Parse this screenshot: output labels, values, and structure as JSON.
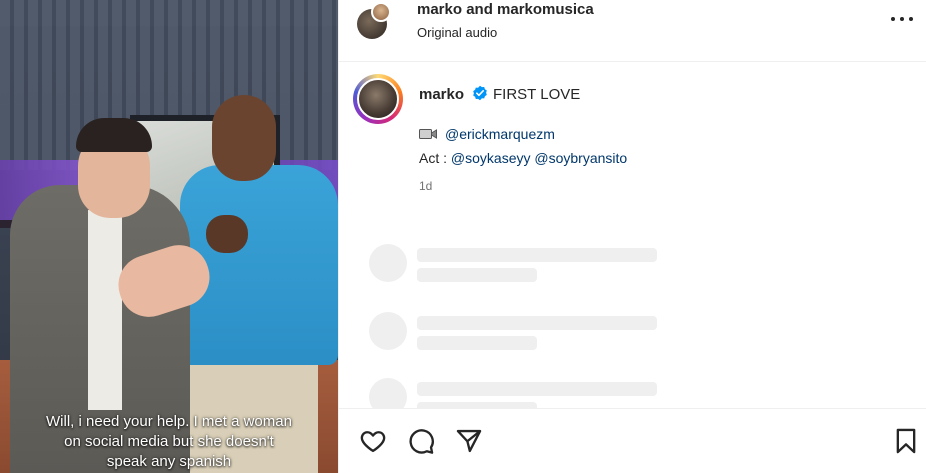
{
  "video": {
    "caption_lines": [
      "Will, i need your help. I met a woman",
      "on social media but she doesn't",
      "speak any spanish"
    ]
  },
  "header": {
    "title": "marko and markomusica",
    "subtitle": "Original audio",
    "more_icon": "more-horizontal-icon"
  },
  "post": {
    "username": "marko",
    "verified_icon": "verified-badge-icon",
    "caption_title": "FIRST LOVE",
    "camera_icon": "video-camera-icon",
    "credit_mention": "@erickmarquezm",
    "act_label": "Act :",
    "act_mentions": [
      "@soykaseyy",
      "@soybryansito"
    ],
    "time": "1d"
  },
  "actions": {
    "like_icon": "heart-icon",
    "comment_icon": "comment-icon",
    "share_icon": "send-icon",
    "save_icon": "bookmark-icon"
  },
  "colors": {
    "text": "#262626",
    "mention": "#00376b",
    "muted": "#737373",
    "verified": "#0095f6",
    "skeleton": "#efefef"
  }
}
